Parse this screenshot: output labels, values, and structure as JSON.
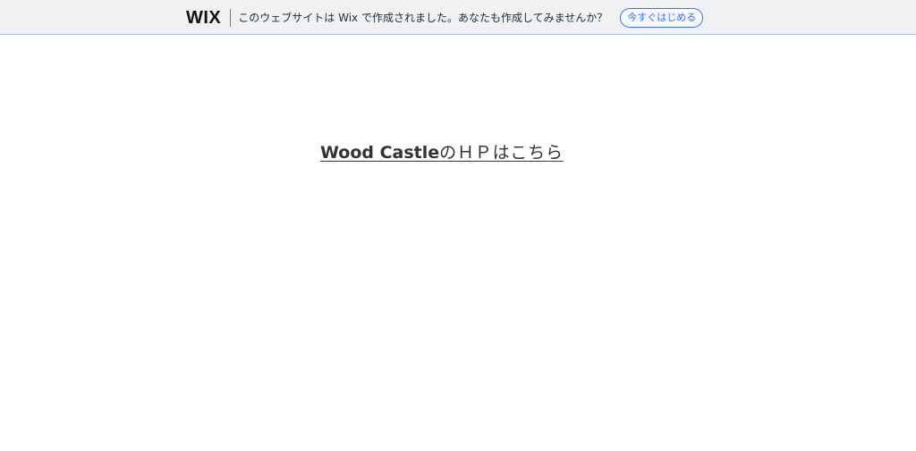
{
  "banner": {
    "logo": "WIX",
    "message": "このウェブサイトは Wix で作成されました。あなたも作成してみませんか？",
    "cta_label": "今すぐはじめる",
    "colors": {
      "background": "#eff1f2",
      "border": "#a9c2f0",
      "accent": "#3c6ef0"
    }
  },
  "main": {
    "link": {
      "emphasis": "Wood Castle",
      "rest": "のＨＰはこちら"
    }
  }
}
